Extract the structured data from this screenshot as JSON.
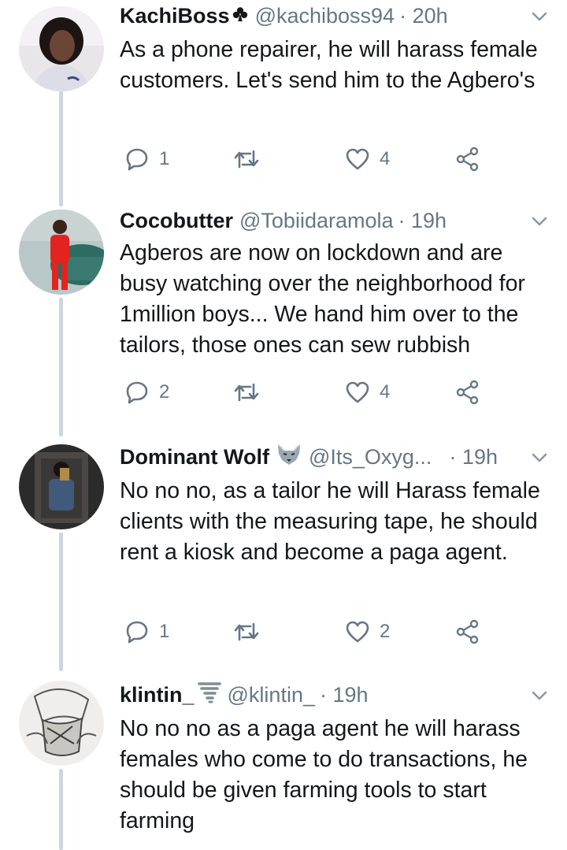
{
  "tweets": [
    {
      "name": "KachiBoss",
      "badge_icon": "club-suit-icon",
      "handle": "@kachiboss94",
      "time": "· 20h",
      "text": "As a phone repairer, he will harass female customers. Let's send him to the Agbero's",
      "replies": "1",
      "likes": "4"
    },
    {
      "name": "Cocobutter",
      "handle": "@Tobiidaramola",
      "time": "· 19h",
      "text": "Agberos are now on lockdown and are busy watching over the neighborhood for 1million boys... We hand him over to the tailors, those ones can sew rubbish",
      "replies": "2",
      "likes": "4"
    },
    {
      "name": "Dominant Wolf",
      "badge_icon": "wolf-emoji-icon",
      "handle": "@Its_Oxyg...",
      "time": "· 19h",
      "text": "No no no, as a tailor he will Harass female clients with the measuring tape, he should rent a kiosk and become a paga agent.",
      "replies": "1",
      "likes": "2"
    },
    {
      "name": "klintin_",
      "badge_icon": "tornado-emoji-icon",
      "handle": "@klintin_",
      "time": "· 19h",
      "text": "No no no as a paga agent he will harass females who come to do transactions, he should be given farming tools to start farming"
    }
  ],
  "icons": {
    "reply": "reply-icon",
    "retweet": "retweet-icon",
    "like": "heart-icon",
    "share": "share-icon",
    "caret": "chevron-down-icon"
  },
  "colors": {
    "text": "#14171a",
    "muted": "#657786",
    "thread_line": "#ccd6dd"
  }
}
